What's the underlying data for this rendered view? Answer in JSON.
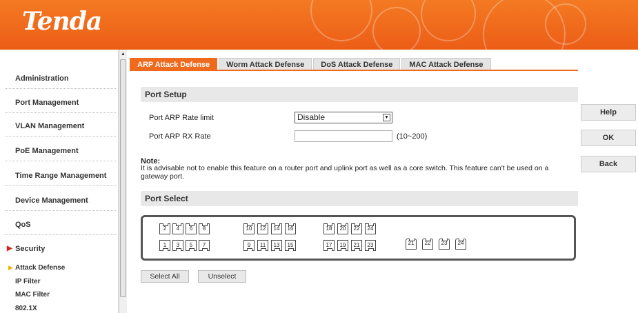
{
  "header": {
    "logo": "Tenda"
  },
  "sidebar": {
    "items": [
      {
        "label": "Administration"
      },
      {
        "label": "Port Management"
      },
      {
        "label": "VLAN Management"
      },
      {
        "label": "PoE Management"
      },
      {
        "label": "Time Range Management"
      },
      {
        "label": "Device Management"
      },
      {
        "label": "QoS"
      },
      {
        "label": "Security"
      }
    ],
    "sub_items": [
      {
        "label": "Attack Defense"
      },
      {
        "label": "IP Filter"
      },
      {
        "label": "MAC Filter"
      },
      {
        "label": "802.1X"
      }
    ]
  },
  "tabs": [
    {
      "label": "ARP Attack Defense"
    },
    {
      "label": "Worm Attack Defense"
    },
    {
      "label": "DoS Attack Defense"
    },
    {
      "label": "MAC Attack Defense"
    }
  ],
  "port_setup": {
    "title": "Port Setup",
    "rate_limit_label": "Port ARP Rate limit",
    "rate_limit_value": "Disable",
    "rx_rate_label": "Port ARP RX Rate",
    "rx_rate_value": "",
    "rx_rate_range": "(10~200)"
  },
  "note": {
    "title": "Note:",
    "text": "It is advisable not to enable this feature on a router port and uplink port as well as a core switch. This feature can't be used on a gateway port."
  },
  "port_select": {
    "title": "Port Select",
    "top_row": [
      "2",
      "4",
      "6",
      "8",
      "10",
      "12",
      "14",
      "16",
      "18",
      "20",
      "22",
      "24"
    ],
    "bottom_row": [
      "1",
      "3",
      "5",
      "7",
      "9",
      "11",
      "13",
      "15",
      "17",
      "19",
      "21",
      "23"
    ],
    "sfp_ports": [
      "21",
      "22",
      "23",
      "24"
    ],
    "select_all": "Select All",
    "unselect": "Unselect"
  },
  "actions": {
    "help": "Help",
    "ok": "OK",
    "back": "Back"
  },
  "colors": {
    "accent": "#ef6a1c",
    "header": "#f47a22"
  }
}
